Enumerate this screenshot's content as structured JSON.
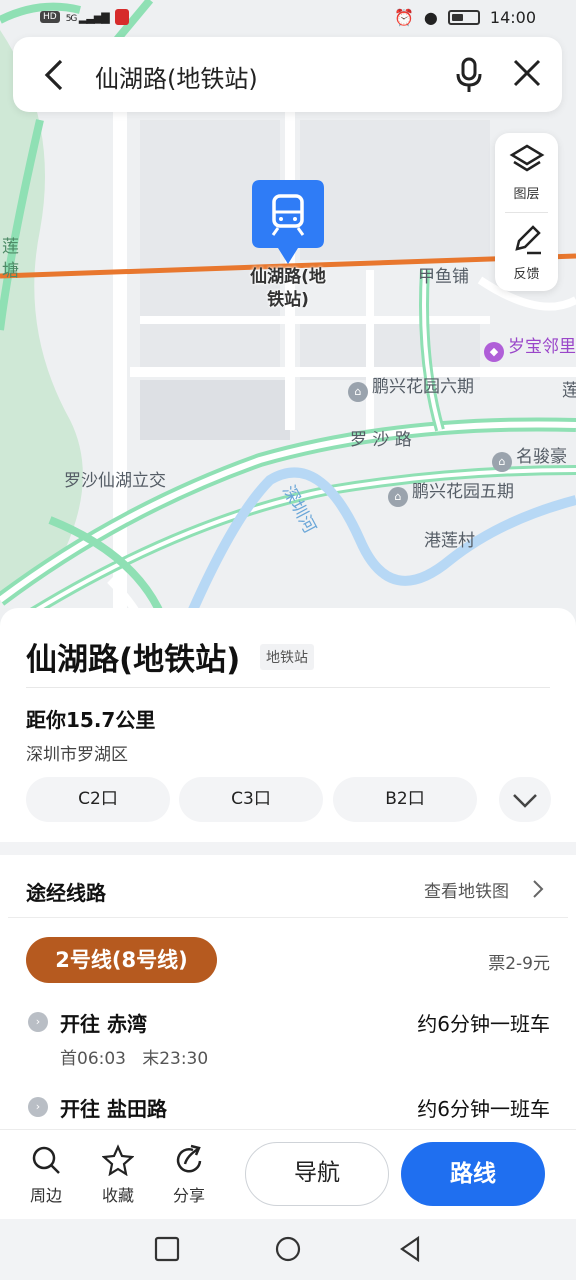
{
  "status_bar": {
    "hd": "HD",
    "network": "5G",
    "time": "14:00",
    "battery_level": 0.45
  },
  "search": {
    "query": "仙湖路(地铁站)",
    "back_icon": "chevron-left-icon",
    "mic_icon": "microphone-icon",
    "close_icon": "close-icon"
  },
  "map": {
    "tools": [
      {
        "label": "图层",
        "icon": "layers-icon"
      },
      {
        "label": "反馈",
        "icon": "edit-feedback-icon"
      }
    ],
    "marker_label": "仙湖路(地\n铁站)",
    "labels": {
      "lian_tang": "莲塘",
      "jiayupu": "甲鱼铺",
      "suibao": "岁宝邻里",
      "pengxing6": "鹏兴花园六期",
      "lian_edge": "莲",
      "luosha_road": "罗 沙 路",
      "mingjun": "名骏豪",
      "luosha_interchange": "罗沙仙湖立交",
      "shenzhen_river": "深圳河",
      "pengxing5": "鹏兴花园五期",
      "ganglian": "港莲村"
    },
    "colors": {
      "metro_line": "#e8772e",
      "road": "#8fe0b4",
      "river": "#b7d8f5",
      "marker": "#2f7cf6"
    }
  },
  "poi": {
    "title": "仙湖路(地铁站)",
    "tag": "地铁站",
    "distance": "距你15.7公里",
    "district": "深圳市罗湖区",
    "exits": [
      "C2口",
      "C3口",
      "B2口"
    ],
    "more_icon": "chevron-down-icon"
  },
  "routes": {
    "title": "途经线路",
    "view_map_link": "查看地铁图",
    "line_name": "2号线(8号线)",
    "line_color": "#b65a1f",
    "fare": "票2-9元",
    "directions": [
      {
        "name": "开往 赤湾",
        "frequency": "约6分钟一班车",
        "hours": "首06:03   末23:30"
      },
      {
        "name": "开往 盐田路",
        "frequency": "约6分钟一班车"
      }
    ]
  },
  "actions": {
    "nearby": "周边",
    "favorite": "收藏",
    "share": "分享",
    "navigate": "导航",
    "route": "路线",
    "route_color": "#1f6ff0"
  }
}
